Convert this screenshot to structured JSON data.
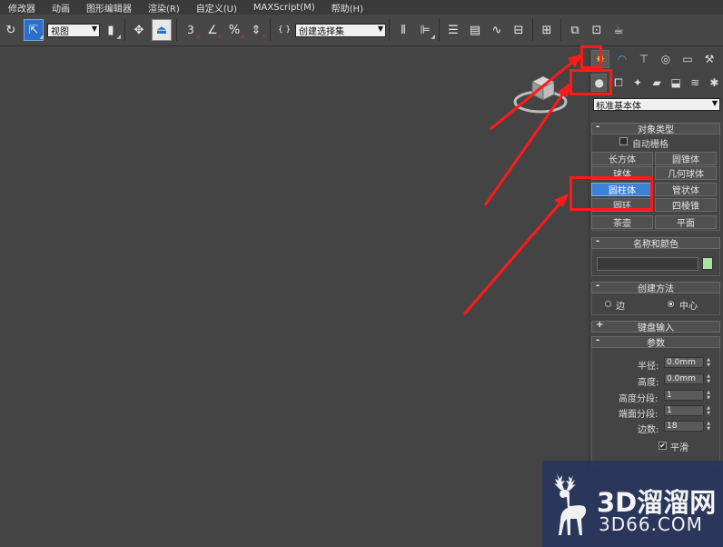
{
  "menu": {
    "items": [
      "修改器",
      "动画",
      "图形编辑器",
      "渲染(R)",
      "自定义(U)",
      "MAXScript(M)",
      "帮助(H)"
    ]
  },
  "toolbar": {
    "view_select": "视图",
    "named_selection": "创建选择集"
  },
  "panel": {
    "category_dropdown": "标准基本体",
    "object_type": {
      "title": "对象类型",
      "autogrid_label": "自动栅格",
      "buttons": [
        "长方体",
        "圆锥体",
        "球体",
        "几何球体",
        "圆柱体",
        "管状体",
        "圆环",
        "四棱锥",
        "茶壶",
        "平面"
      ],
      "active_button": "圆柱体"
    },
    "name_color": {
      "title": "名称和颜色",
      "name_value": "",
      "color": "#a6e3a0"
    },
    "creation_method": {
      "title": "创建方法",
      "options": [
        "边",
        "中心"
      ],
      "selected": "中心"
    },
    "keyboard_entry": {
      "title": "键盘输入"
    },
    "parameters": {
      "title": "参数",
      "fields": [
        {
          "label": "半径:",
          "value": "0.0mm"
        },
        {
          "label": "高度:",
          "value": "0.0mm"
        },
        {
          "label": "高度分段:",
          "value": "1"
        },
        {
          "label": "端面分段:",
          "value": "1"
        },
        {
          "label": "边数:",
          "value": "18"
        }
      ],
      "smooth_label": "平滑",
      "smooth_checked": true
    }
  },
  "watermark": {
    "title": "3D溜溜网",
    "subtitle": "3D66.COM"
  },
  "colors": {
    "highlight_box": "#ff1a1a",
    "active_button": "#3c83d8"
  }
}
